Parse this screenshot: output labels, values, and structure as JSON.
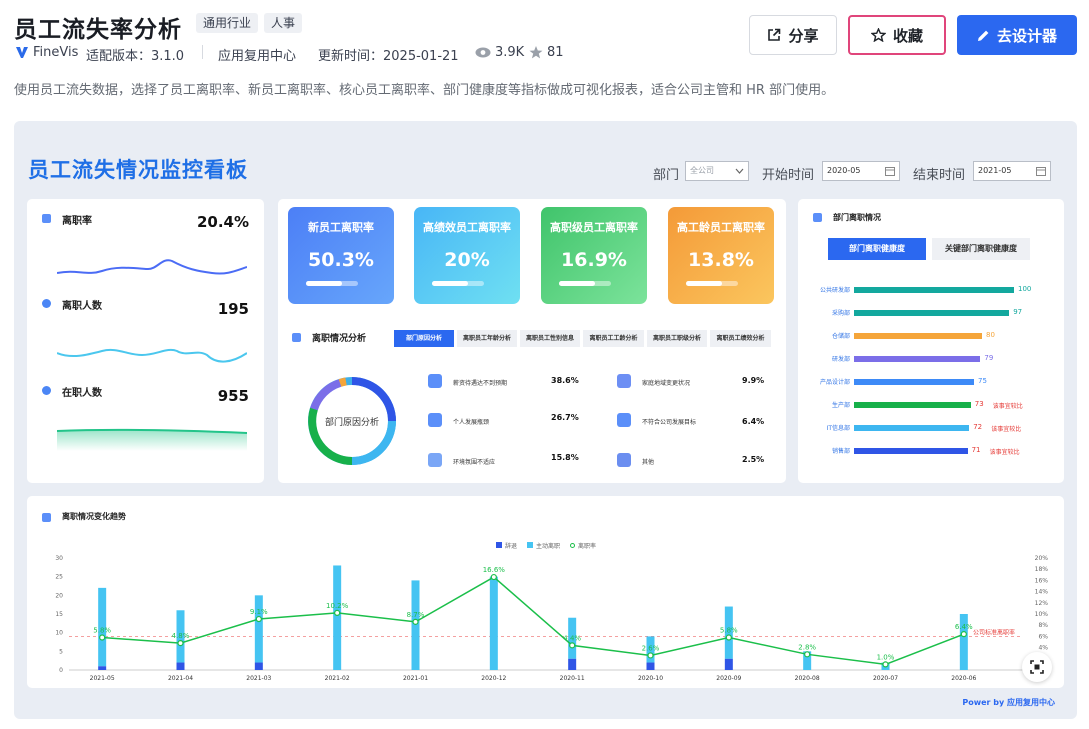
{
  "header": {
    "title": "员工流失率分析",
    "tags": [
      "通用行业",
      "人事"
    ],
    "brand": "FineVis",
    "version": "适配版本：3.1.0",
    "center": "应用复用中心",
    "updated": "更新时间：2025-01-21",
    "views": "3.9K",
    "stars": "81",
    "share_label": "分享",
    "favorite_label": "收藏",
    "designer_label": "去设计器",
    "description": "使用员工流失数据，选择了员工离职率、新员工离职率、核心员工离职率、部门健康度等指标做成可视化报表，适合公司主管和 HR 部门使用。"
  },
  "dashboard": {
    "title": "员工流失情况监控看板",
    "filters": {
      "dept_label": "部门",
      "dept_value": "全公司",
      "start_label": "开始时间",
      "start_value": "2020-05",
      "end_label": "结束时间",
      "end_value": "2021-05"
    },
    "kpis": [
      {
        "label": "离职率",
        "value": "20.4%"
      },
      {
        "label": "离职人数",
        "value": "195"
      },
      {
        "label": "在职人数",
        "value": "955"
      }
    ],
    "rate_cards": [
      {
        "label": "新员工离职率",
        "value": "50.3%"
      },
      {
        "label": "高绩效员工离职率",
        "value": "20%"
      },
      {
        "label": "高职级员工离职率",
        "value": "16.9%"
      },
      {
        "label": "高工龄员工离职率",
        "value": "13.8%"
      }
    ],
    "analysis": {
      "title": "离职情况分析",
      "tabs": [
        "部门原因分析",
        "离职员工年龄分析",
        "离职员工性别信息",
        "离职员工工龄分析",
        "离职员工职级分析",
        "离职员工绩效分析"
      ],
      "donut_label": "部门原因分析",
      "reasons": [
        {
          "label": "薪资待遇达不到预期",
          "value": "38.6%",
          "color": "#4e8af2"
        },
        {
          "label": "家庭地域变更状况",
          "value": "9.9%",
          "color": "#6d8ff4"
        },
        {
          "label": "个人发展瓶颈",
          "value": "26.7%",
          "color": "#5b8ff9"
        },
        {
          "label": "不符合公司发展目标",
          "value": "6.4%",
          "color": "#5b8ff9"
        },
        {
          "label": "环境氛围不适应",
          "value": "15.8%",
          "color": "#7aa6f6"
        },
        {
          "label": "其他",
          "value": "2.5%",
          "color": "#6b8ef0"
        }
      ]
    },
    "dept": {
      "title": "部门离职情况",
      "tabs": [
        "部门离职健康度",
        "关键部门离职健康度"
      ],
      "note": "该事宜较比",
      "rows": [
        {
          "name": "公共研发部",
          "value": 100,
          "color": "#13a89e"
        },
        {
          "name": "采购部",
          "value": 97,
          "color": "#13a89e"
        },
        {
          "name": "仓储部",
          "value": 80,
          "color": "#f5a53a"
        },
        {
          "name": "研发部",
          "value": 79,
          "color": "#7b6ee8"
        },
        {
          "name": "产品设计部",
          "value": 75,
          "color": "#3d8af7"
        },
        {
          "name": "生产部",
          "value": 73,
          "color": "#17b04a"
        },
        {
          "name": "IT信息部",
          "value": 72,
          "color": "#3db6f0"
        },
        {
          "name": "销售部",
          "value": 71,
          "color": "#2f55e6"
        }
      ]
    },
    "trend": {
      "title": "离职情况变化趋势",
      "legend": [
        "辞退",
        "主动离职",
        "离职率"
      ],
      "ref_label": "公司标准离职率",
      "footer": "Power by 应用复用中心"
    }
  },
  "chart_data": {
    "type": "bar",
    "categories": [
      "2021-05",
      "2021-04",
      "2021-03",
      "2021-02",
      "2021-01",
      "2020-12",
      "2020-11",
      "2020-10",
      "2020-09",
      "2020-08",
      "2020-07",
      "2020-06"
    ],
    "series": [
      {
        "name": "辞退",
        "values": [
          1,
          2,
          2,
          0,
          0,
          0,
          3,
          2,
          3,
          0,
          0,
          0
        ]
      },
      {
        "name": "主动离职",
        "values": [
          21,
          14,
          18,
          28,
          24,
          25,
          11,
          7,
          14,
          5,
          2,
          15
        ]
      },
      {
        "name": "离职率",
        "values": [
          5.8,
          4.8,
          9.1,
          10.2,
          8.6,
          16.6,
          4.4,
          2.6,
          5.8,
          2.8,
          1.0,
          6.4
        ]
      }
    ],
    "labels": [
      "5.8%",
      "4.8%",
      "9.1%",
      "10.2%",
      "8.7%",
      "16.6%",
      "4.4%",
      "2.6%",
      "5.8%",
      "2.8%",
      "1.0%",
      "6.4%"
    ],
    "y_ticks": [
      "0",
      "5",
      "10",
      "15",
      "20",
      "25",
      "30"
    ],
    "y2_ticks": [
      "0%",
      "2%",
      "4%",
      "6%",
      "8%",
      "10%",
      "12%",
      "14%",
      "16%",
      "18%",
      "20%"
    ],
    "ylim": [
      0,
      30
    ],
    "y2lim": [
      0,
      20
    ],
    "reference_rate": 6,
    "colors": {
      "辞退": "#2f55e6",
      "主动离职": "#45c4f2",
      "离职率": "#1bbf4a"
    }
  }
}
